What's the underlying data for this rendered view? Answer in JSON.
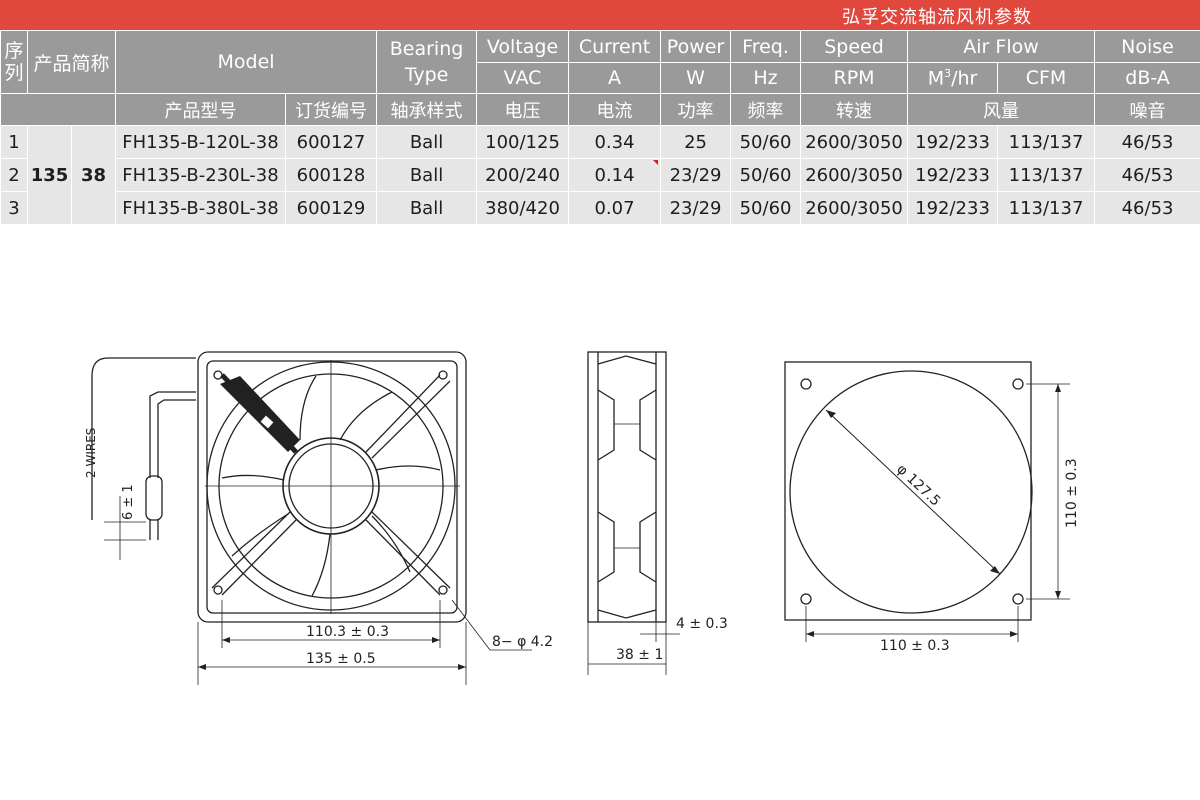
{
  "banner": {
    "title": "弘孚交流轴流风机参数"
  },
  "header": {
    "seq": [
      "序",
      "列"
    ],
    "abbr": "产品简称",
    "model": "Model",
    "bearing": [
      "Bearing",
      "Type"
    ],
    "voltage": "Voltage",
    "current": "Current",
    "power": "Power",
    "freq": "Freq.",
    "speed": "Speed",
    "airflow": "Air Flow",
    "noise": "Noise",
    "unit_vac": "VAC",
    "unit_a": "A",
    "unit_w": "W",
    "unit_hz": "Hz",
    "unit_rpm": "RPM",
    "unit_m3_base": "M",
    "unit_m3_sup": "3",
    "unit_m3_tail": "/hr",
    "unit_cfm": "CFM",
    "unit_dba": "dB-A",
    "cn_model": "产品型号",
    "cn_order": "订货编号",
    "cn_bearing": "轴承样式",
    "cn_voltage": "电压",
    "cn_current": "电流",
    "cn_power": "功率",
    "cn_freq": "频率",
    "cn_speed": "转速",
    "cn_airflow": "风量",
    "cn_noise": "噪音"
  },
  "abbr_values": {
    "size": "135",
    "thickness": "38"
  },
  "rows": [
    {
      "no": "1",
      "model": "FH135-B-120L-38",
      "order": "600127",
      "bearing": "Ball",
      "voltage": "100/125",
      "current": "0.34",
      "power": "25",
      "freq": "50/60",
      "speed": "2600/3050",
      "m3": "192/233",
      "cfm": "113/137",
      "noise": "46/53"
    },
    {
      "no": "2",
      "model": "FH135-B-230L-38",
      "order": "600128",
      "bearing": "Ball",
      "voltage": "200/240",
      "current": "0.14",
      "power": "23/29",
      "freq": "50/60",
      "speed": "2600/3050",
      "m3": "192/233",
      "cfm": "113/137",
      "noise": "46/53"
    },
    {
      "no": "3",
      "model": "FH135-B-380L-38",
      "order": "600129",
      "bearing": "Ball",
      "voltage": "380/420",
      "current": "0.07",
      "power": "23/29",
      "freq": "50/60",
      "speed": "2600/3050",
      "m3": "192/233",
      "cfm": "113/137",
      "noise": "46/53"
    }
  ],
  "drawing": {
    "wires": "2 WIRES",
    "wire_dim": "6 ± 1",
    "inner_width": "110.3 ± 0.3",
    "outer_width": "135 ± 0.5",
    "holes": "8− φ 4.2",
    "flange": "4 ± 0.3",
    "depth": "38 ± 1",
    "diameter": "φ 127.5",
    "rear_width": "110 ± 0.3",
    "rear_height": "110 ± 0.3"
  }
}
